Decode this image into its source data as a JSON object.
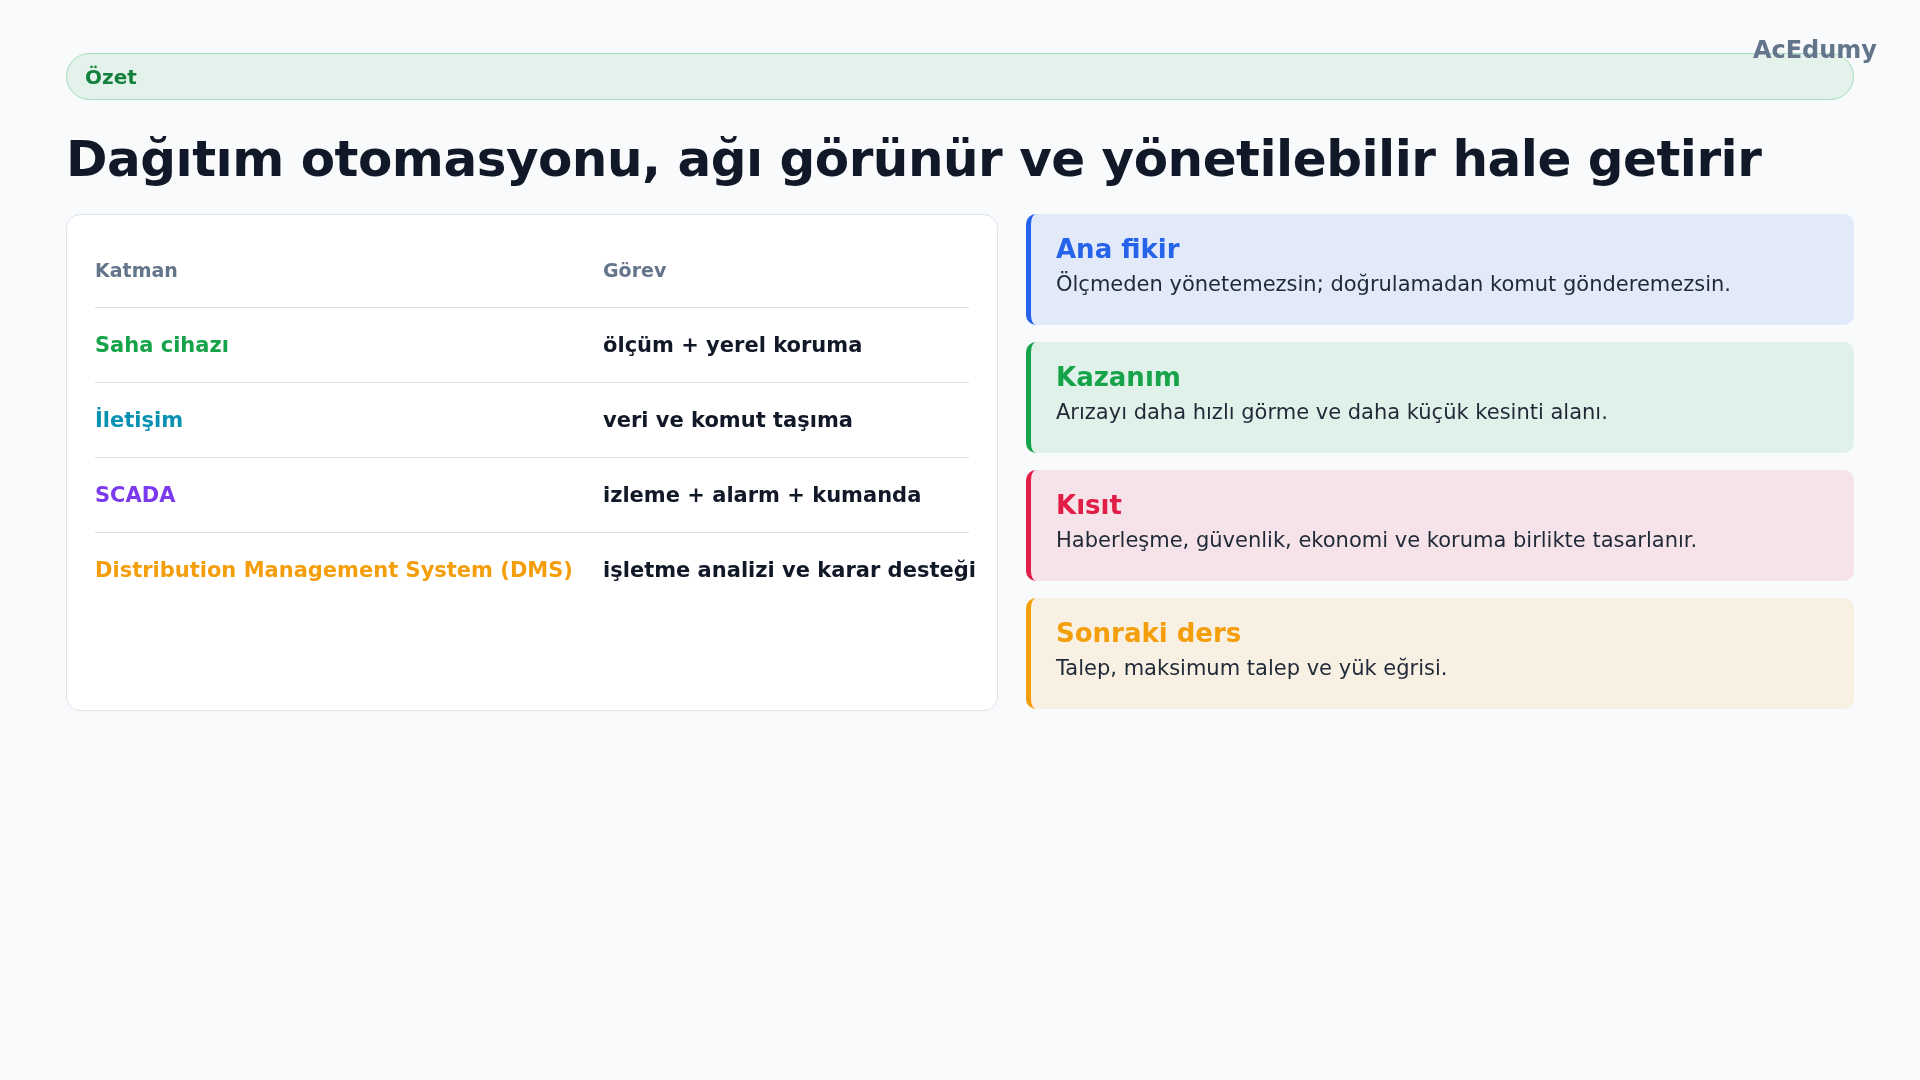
{
  "brand": "AcEdumy",
  "section_pill": "Özet",
  "title": "Dağıtım otomasyonu, ağı görünür ve yönetilebilir hale getirir",
  "table": {
    "columns": [
      "Katman",
      "Görev"
    ],
    "rows": [
      {
        "layer": "Saha cihazı",
        "task": "ölçüm + yerel koruma",
        "color": "#16a34a"
      },
      {
        "layer": "İletişim",
        "task": "veri ve komut taşıma",
        "color": "#0891b2"
      },
      {
        "layer": "SCADA",
        "task": "izleme + alarm + kumanda",
        "color": "#7c3aed"
      },
      {
        "layer": "Distribution Management System (DMS)",
        "task": "işletme analizi ve karar desteği",
        "color": "#f59e0b"
      }
    ]
  },
  "cards": [
    {
      "title": "Ana fikir",
      "text": "Ölçmeden yönetemezsin; doğrulamadan komut gönderemezsin.",
      "color": "#2563eb"
    },
    {
      "title": "Kazanım",
      "text": "Arızayı daha hızlı görme ve daha küçük kesinti alanı.",
      "color": "#16a34a"
    },
    {
      "title": "Kısıt",
      "text": "Haberleşme, güvenlik, ekonomi ve koruma birlikte tasarlanır.",
      "color": "#e11d48"
    },
    {
      "title": "Sonraki ders",
      "text": "Talep, maksimum talep ve yük eğrisi.",
      "color": "#f59e0b"
    }
  ]
}
